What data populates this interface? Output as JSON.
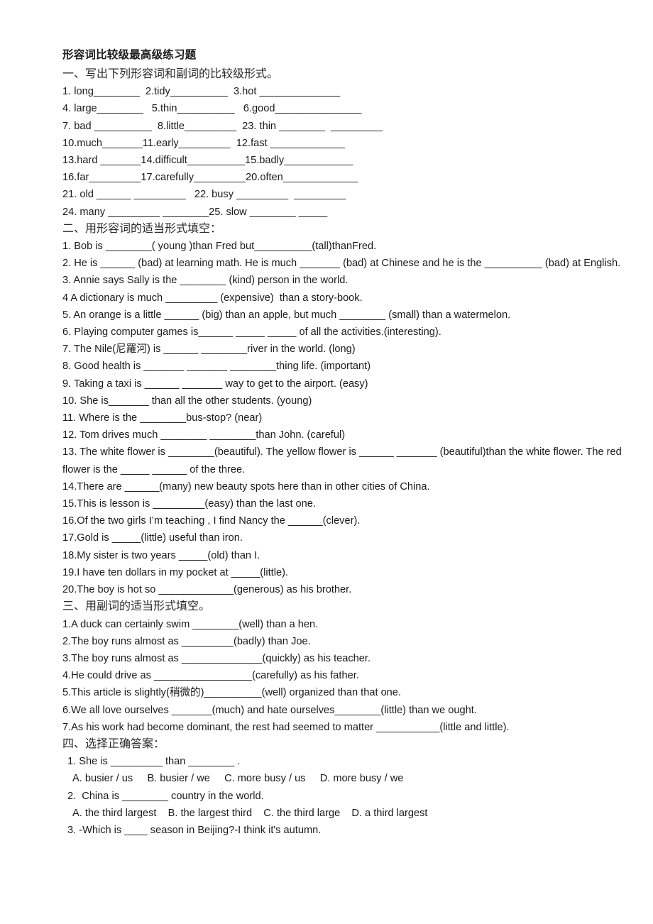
{
  "document": {
    "title": "形容词比较级最高级练习题",
    "sections": [
      {
        "heading": "一、写出下列形容词和副词的比较级形式。",
        "lines": [
          "1. long________  2.tidy__________  3.hot ______________",
          "4. large________   5.thin__________   6.good_______________",
          "7. bad __________  8.little_________  23. thin ________  _________",
          "10.much_______11.early_________  12.fast _____________",
          "13.hard _______14.difficult__________15.badly____________",
          "16.far_________17.carefully_________20.often_____________",
          "21. old ______ _________   22. busy _________  _________",
          "24. many _________ ________25. slow ________ _____"
        ]
      },
      {
        "heading": "二、用形容词的适当形式填空：",
        "lines": [
          "1. Bob is ________( young )than Fred but__________(tall)thanFred.",
          "2. He is ______ (bad) at learning math. He is much _______ (bad) at Chinese and he is the  __________ (bad) at English.",
          "3. Annie says Sally is the ________ (kind) person in the world.",
          "4 A dictionary is much _________ (expensive)  than a story-book.",
          "5. An orange is a little ______ (big) than an apple, but much ________ (small) than a watermelon.",
          "6. Playing computer games is______ _____ _____ of all the activities.(interesting).",
          "7. The Nile(尼羅河) is ______ ________river in the world. (long)",
          "8. Good health is _______ _______ ________thing life. (important)",
          "9. Taking a taxi is ______ _______ way to get to the airport. (easy)",
          "10. She is_______ than all the other students. (young)",
          "11. Where is the ________bus-stop? (near)",
          "12. Tom drives much ________ ________than John. (careful)",
          "13. The white flower is ________(beautiful). The yellow flower is ______ _______ (beautiful)than the white flower. The red flower is the _____ ______ of the three.",
          "14.There are ______(many) new beauty spots here than in other cities of China.",
          "15.This is lesson is _________(easy) than the last one.",
          "16.Of the two girls I’m teaching , I find Nancy the ______(clever).",
          "17.Gold is _____(little) useful than iron.",
          "18.My sister is two years _____(old) than I.",
          "19.I have ten dollars in my pocket at _____(little).",
          "20.The boy is hot so _____________(generous) as his brother."
        ]
      },
      {
        "heading": "三、用副词的适当形式填空。",
        "lines": [
          "1.A duck can certainly swim ________(well) than a hen.",
          "2.The boy runs almost as _________(badly) than Joe.",
          "3.The boy runs almost as ______________(quickly) as his teacher.",
          "4.He could drive as _________________(carefully) as his father.",
          "5.This article is slightly(稍微的)__________(well) organized than that one.",
          "6.We all love ourselves _______(much) and hate ourselves________(little) than we ought.",
          "7.As his work had become dominant, the rest had seemed to matter ___________(little and little)."
        ]
      },
      {
        "heading": "四、选择正确答案：",
        "questions": [
          {
            "stem": "1. She is _________ than ________ .",
            "options": "A. busier / us     B. busier / we     C. more busy / us     D. more busy / we"
          },
          {
            "stem": "2.  China is ________ country in the world.",
            "options": "A. the third largest    B. the largest third    C. the third large    D. a third largest"
          },
          {
            "stem": "3. -Which is ____ season in Beijing?-I think it's autumn.",
            "options": ""
          }
        ]
      }
    ]
  }
}
